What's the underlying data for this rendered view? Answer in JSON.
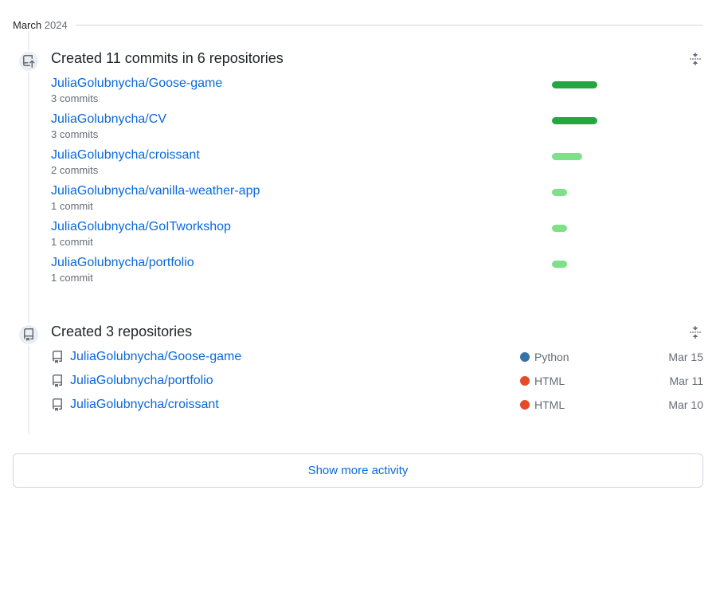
{
  "header": {
    "month": "March",
    "year": "2024"
  },
  "commits_section": {
    "title": "Created 11 commits in 6 repositories",
    "repos": [
      {
        "name": "JuliaGolubnycha/Goose-game",
        "commits_text": "3 commits",
        "bar_pct": 30,
        "bar_color": "#26a641"
      },
      {
        "name": "JuliaGolubnycha/CV",
        "commits_text": "3 commits",
        "bar_pct": 30,
        "bar_color": "#26a641"
      },
      {
        "name": "JuliaGolubnycha/croissant",
        "commits_text": "2 commits",
        "bar_pct": 20,
        "bar_color": "#7ee088"
      },
      {
        "name": "JuliaGolubnycha/vanilla-weather-app",
        "commits_text": "1 commit",
        "bar_pct": 10,
        "bar_color": "#7ee088"
      },
      {
        "name": "JuliaGolubnycha/GoITworkshop",
        "commits_text": "1 commit",
        "bar_pct": 10,
        "bar_color": "#7ee088"
      },
      {
        "name": "JuliaGolubnycha/portfolio",
        "commits_text": "1 commit",
        "bar_pct": 10,
        "bar_color": "#7ee088"
      }
    ]
  },
  "repos_section": {
    "title": "Created 3 repositories",
    "repos": [
      {
        "name": "JuliaGolubnycha/Goose-game",
        "lang": "Python",
        "lang_color": "#3572A5",
        "date": "Mar 15"
      },
      {
        "name": "JuliaGolubnycha/portfolio",
        "lang": "HTML",
        "lang_color": "#e34c26",
        "date": "Mar 11"
      },
      {
        "name": "JuliaGolubnycha/croissant",
        "lang": "HTML",
        "lang_color": "#e34c26",
        "date": "Mar 10"
      }
    ]
  },
  "show_more": "Show more activity"
}
